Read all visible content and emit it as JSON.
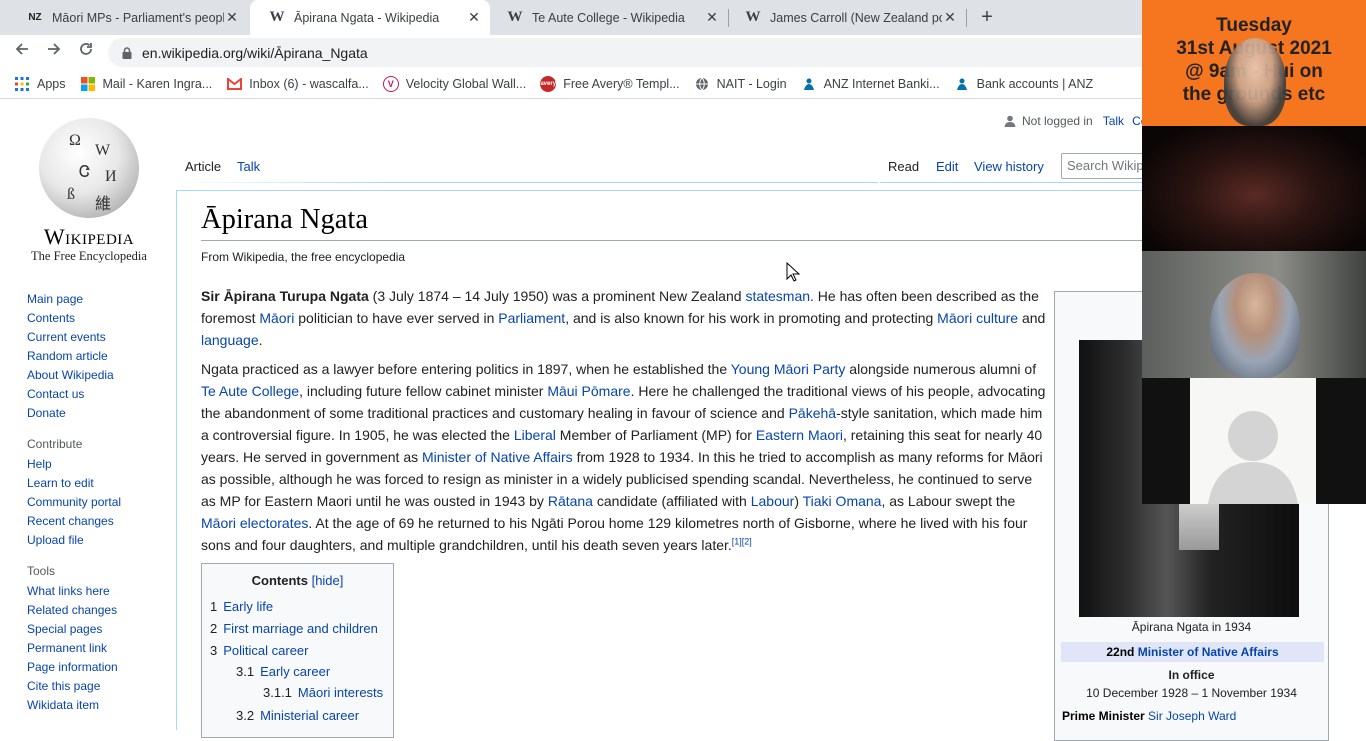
{
  "browser": {
    "tabs": [
      {
        "favicon": "NZ",
        "title": "Māori MPs - Parliament's people",
        "active": false
      },
      {
        "favicon": "W",
        "title": "Āpirana Ngata - Wikipedia",
        "active": true
      },
      {
        "favicon": "W",
        "title": "Te Aute College - Wikipedia",
        "active": false
      },
      {
        "favicon": "W",
        "title": "James Carroll (New Zealand politician)",
        "active": false
      }
    ],
    "close_glyph": "✕",
    "new_tab_glyph": "+",
    "url": "en.wikipedia.org/wiki/Āpirana_Ngata",
    "bookmarks": [
      {
        "icon": "apps-grid-icon",
        "label": "Apps"
      },
      {
        "icon": "microsoft-icon",
        "label": "Mail - Karen Ingra..."
      },
      {
        "icon": "gmail-icon",
        "label": "Inbox (6) - wascalfa..."
      },
      {
        "icon": "velocity-icon",
        "label": "Velocity Global Wall..."
      },
      {
        "icon": "avery-icon",
        "label": "Free Avery® Templ..."
      },
      {
        "icon": "globe-icon",
        "label": "NAIT - Login"
      },
      {
        "icon": "anz-icon",
        "label": "ANZ Internet Banki..."
      },
      {
        "icon": "anz-icon",
        "label": "Bank accounts | ANZ"
      }
    ]
  },
  "wiki": {
    "wordmark": "Wikipedia",
    "tagline": "The Free Encyclopedia",
    "nav_main": [
      "Main page",
      "Contents",
      "Current events",
      "Random article",
      "About Wikipedia",
      "Contact us",
      "Donate"
    ],
    "contribute_head": "Contribute",
    "nav_contribute": [
      "Help",
      "Learn to edit",
      "Community portal",
      "Recent changes",
      "Upload file"
    ],
    "tools_head": "Tools",
    "nav_tools": [
      "What links here",
      "Related changes",
      "Special pages",
      "Permanent link",
      "Page information",
      "Cite this page",
      "Wikidata item"
    ],
    "personal": {
      "not_logged": "Not logged in",
      "talk": "Talk",
      "contrib": "Co"
    },
    "tabs": {
      "article": "Article",
      "talk": "Talk",
      "read": "Read",
      "edit": "Edit",
      "history": "View history"
    },
    "search_placeholder": "Search Wikipedia",
    "title": "Āpirana Ngata",
    "from": "From Wikipedia, the free encyclopedia",
    "p1": {
      "bold": "Sir Āpirana Turupa Ngata",
      "t1": " (3 July 1874 – 14 July 1950) was a prominent New Zealand ",
      "l1": "statesman",
      "t2": ". He has often been described as the foremost ",
      "l2": "Māori",
      "t3": " politician to have ever served in ",
      "l3": "Parliament",
      "t4": ", and is also known for his work in promoting and protecting ",
      "l4": "Māori culture",
      "t5": " and ",
      "l5": "language",
      "t6": "."
    },
    "p2": {
      "t1": "Ngata practiced as a lawyer before entering politics in 1897, when he established the ",
      "l1": "Young Māori Party",
      "t2": " alongside numerous alumni of ",
      "l2": "Te Aute College",
      "t3": ", including future fellow cabinet minister ",
      "l3": "Māui Pōmare",
      "t4": ". Here he challenged the traditional views of his people, advocating the abandonment of some traditional practices and customary healing in favour of science and ",
      "l4": "Pākehā",
      "t5": "-style sanitation, which made him a controversial figure. In 1905, he was elected the ",
      "l5": "Liberal",
      "t6": " Member of Parliament (MP) for ",
      "l6": "Eastern Maori",
      "t7": ", retaining this seat for nearly 40 years. He served in government as ",
      "l7": "Minister of Native Affairs",
      "t8": " from 1928 to 1934. In this he tried to accomplish as many reforms for Māori as possible, although he was forced to resign as minister in a widely publicised spending scandal. Nevertheless, he continued to serve as MP for Eastern Maori until he was ousted in 1943 by ",
      "l8": "Rātana",
      "t9": " candidate (affiliated with ",
      "l9": "Labour",
      "t10": ") ",
      "l10": "Tiaki Omana",
      "t11": ", as Labour swept the ",
      "l11": "Māori electorates",
      "t12": ". At the age of 69 he returned to his Ngāti Porou home 129 kilometres north of Gisborne, where he lived with his four sons and four daughters, and multiple grandchildren, until his death seven years later.",
      "ref1": "[1]",
      "ref2": "[2]"
    },
    "toc": {
      "title": "Contents",
      "hide": "[hide]",
      "items": [
        {
          "num": "1",
          "label": "Early life"
        },
        {
          "num": "2",
          "label": "First marriage and children"
        },
        {
          "num": "3",
          "label": "Political career"
        },
        {
          "num": "3.1",
          "label": "Early career"
        },
        {
          "num": "3.1.1",
          "label": "Māori interests"
        },
        {
          "num": "3.2",
          "label": "Ministerial career"
        }
      ]
    },
    "infobox": {
      "caption": "Āpirana Ngata in 1934",
      "office_ordinal": "22nd",
      "office_link": "Minister of Native Affairs",
      "in_office": "In office",
      "term": "10 December 1928 – 1 November 1934",
      "pm_label": "Prime Minister",
      "pm_name": "Sir Joseph Ward"
    }
  },
  "video_call": {
    "banner_lines": [
      "Tuesday",
      "31st August 2021",
      "@ 9am - Hui on",
      "the grounds etc"
    ]
  }
}
